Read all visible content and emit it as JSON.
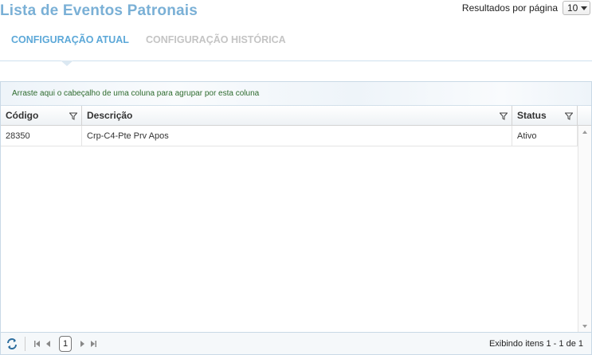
{
  "header": {
    "title": "Lista de Eventos Patronais",
    "per_page_label": "Resultados por página",
    "per_page_value": "10"
  },
  "tabs": [
    {
      "label": "CONFIGURAÇÃO ATUAL",
      "active": true
    },
    {
      "label": "CONFIGURAÇÃO HISTÓRICA",
      "active": false
    }
  ],
  "grid": {
    "group_hint": "Arraste aqui o cabeçalho de uma coluna para agrupar por esta coluna",
    "columns": [
      "Código",
      "Descrição",
      "Status"
    ],
    "rows": [
      {
        "codigo": "28350",
        "descricao": "Crp-C4-Pte Prv Apos",
        "status": "Ativo"
      }
    ]
  },
  "pager": {
    "current_page": "1",
    "info": "Exibindo itens 1 - 1 de 1"
  },
  "colors": {
    "title": "#7ab0d6",
    "tab_active": "#5ca8d8",
    "tab_inactive": "#c4c4c4",
    "group_hint": "#2e6b2e"
  }
}
